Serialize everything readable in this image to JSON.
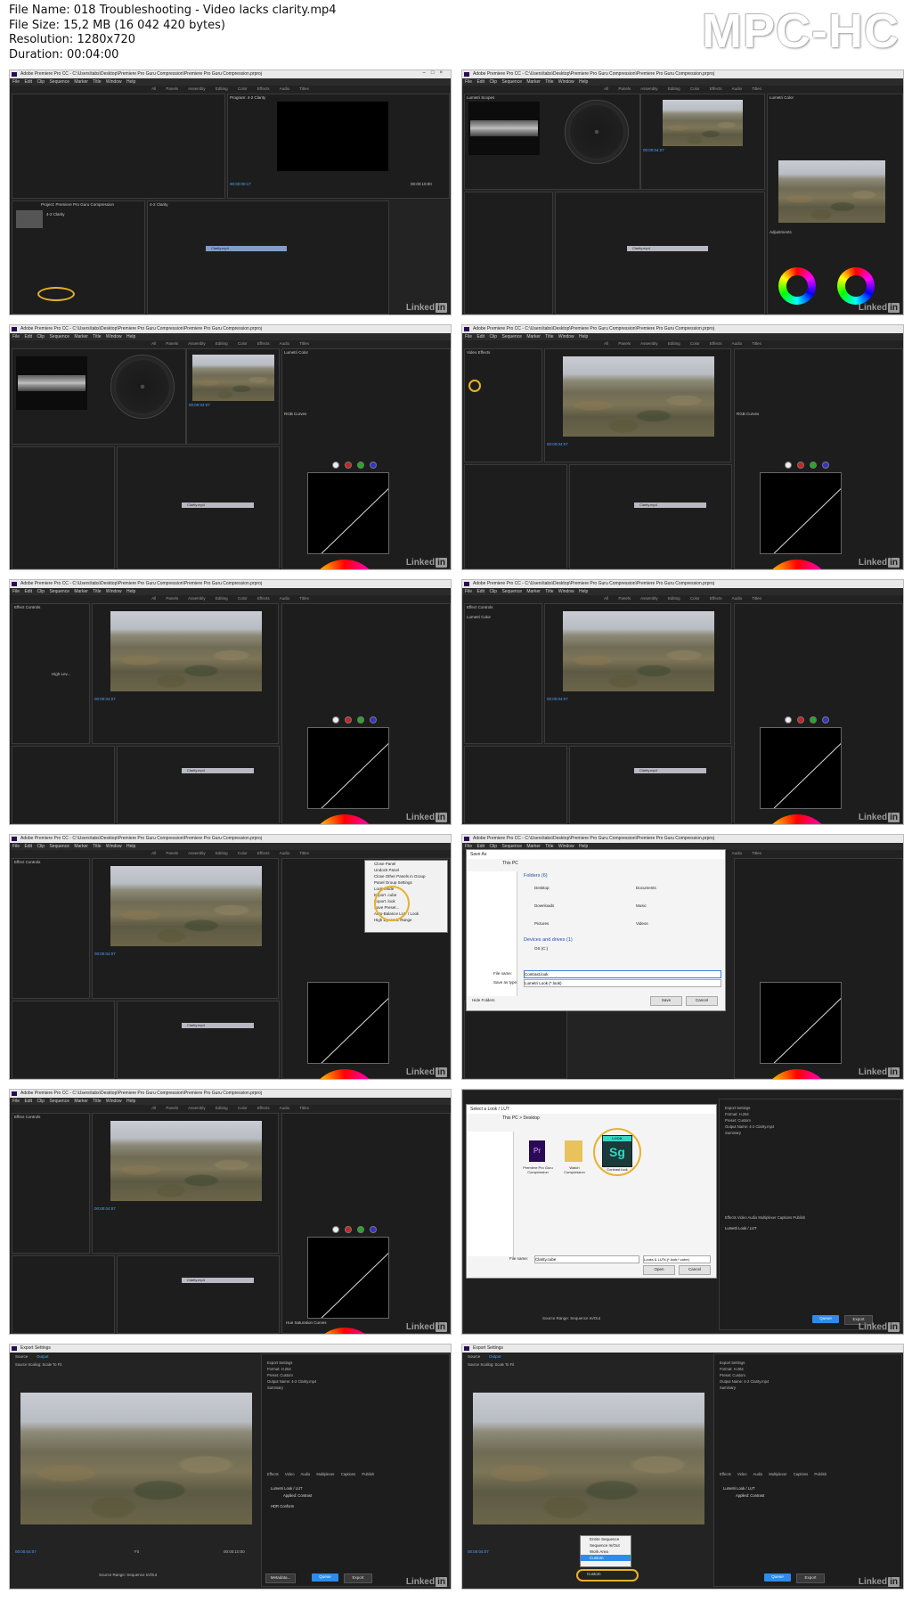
{
  "file_info": {
    "file_name": "File Name: 018 Troubleshooting - Video lacks clarity.mp4",
    "file_size": "File Size: 15,2 MB (16 042 420 bytes)",
    "resolution": "Resolution: 1280x720",
    "duration": "Duration: 00:04:00"
  },
  "logo": "MPC-HC",
  "app": {
    "title": "Adobe Premiere Pro CC - C:\\Users\\tabs\\Desktop\\Premiere Pro Guru Compression\\Premiere Pro Guru Compression.prproj",
    "menu": "File Edit Clip Sequence Marker Title Window Help",
    "workspaces": "All Panels Assembly Editing Color Effects Audio Titles",
    "program_label": "Program: 4-2 Clarity",
    "lumetri_label": "Lumetri Color",
    "timecode_a": "00:00:00:17",
    "timecode_b": "00:00:04:07",
    "timecode_end": "00:00:10:00",
    "clip_name": "Clarity.mp4",
    "watermark": "Linked",
    "watermark_in": "in"
  },
  "frames": [
    {
      "caption": "Project: Premiere Pro Guru Compression",
      "extra": "4-2 Clarity"
    },
    {
      "caption": "Lumetri Scopes",
      "extra": "Adjustments"
    },
    {
      "caption": "Lumetri Scopes",
      "extra": "RGB Curves"
    },
    {
      "caption": "Video Effects",
      "extra": "RGB Curves"
    },
    {
      "caption": "Effect Controls",
      "extra": "High Lev..."
    },
    {
      "caption": "Effect Controls",
      "extra": "Lumetri Color"
    },
    {
      "caption": "Effect Controls",
      "extra": "Export Look"
    },
    {
      "caption": "Save As",
      "extra": "Folders (6)"
    },
    {
      "caption": "Effect Controls",
      "extra": "Hue Saturation Curves"
    },
    {
      "caption": "Select a Look / LUT",
      "extra": "Contrast.look"
    },
    {
      "caption": "Export Settings",
      "extra": "Lumetri Look / LUT"
    },
    {
      "caption": "Export Settings",
      "extra": "Source Range"
    }
  ],
  "context_menu": [
    "Close Panel",
    "Undock Panel",
    "Close Other Panels in Group",
    "Panel Group Settings",
    "Look Mode",
    "Export .cube",
    "Export .look",
    "Save Preset...",
    "Auto-Balance LUT / Look",
    "High Dynamic Range"
  ],
  "save_dialog": {
    "title": "Save As",
    "path": "This PC",
    "folders_title": "Folders (6)",
    "folders": [
      "Desktop",
      "Documents",
      "Downloads",
      "Music",
      "Pictures",
      "Videos"
    ],
    "devices_title": "Devices and drives (1)",
    "drive": "OS (C:)",
    "file_name_label": "File name:",
    "file_name_value": "Contrast.look",
    "save_type_label": "Save as type:",
    "save_type_value": "Lumetri Look (*.look)",
    "save_btn": "Save",
    "cancel_btn": "Cancel",
    "hide_folders": "Hide Folders"
  },
  "open_dialog": {
    "title": "Select a Look / LUT",
    "path": "This PC > Desktop",
    "files": [
      "Premiere Pro Guru Compression",
      "Watch Compression",
      "Contrast.look"
    ],
    "file_name_label": "File name:",
    "file_name_value": "Clarity.cube",
    "filter": "Looks & LUTs (*.look;*.cube)",
    "open_btn": "Open",
    "cancel_btn": "Cancel",
    "sg_label": "Sg",
    "sg_tag": "LOOK"
  },
  "export": {
    "title": "Export Settings",
    "source_tab": "Source",
    "output_tab": "Output",
    "source_scaling": "Source Scaling: Scale To Fit",
    "settings_header": "Export Settings",
    "format": "Format: H.264",
    "preset": "Preset: Custom",
    "output_name": "Output Name: 4-2 Clarity.mp4",
    "summary": "Summary",
    "tabs": "Effects Video Audio Multiplexer Captions Publish",
    "lumetri": "Lumetri Look / LUT",
    "applied": "Applied: Contrast",
    "hdr": "HDR Conform",
    "queue_btn": "Queue",
    "export_btn": "Export",
    "metadata_btn": "Metadata...",
    "cancel_btn": "Cancel",
    "source_range": "Source Range: Sequence In/Out",
    "range_menu": [
      "Entire Sequence",
      "Sequence In/Out",
      "Work Area",
      "Custom"
    ],
    "range_selected": "Custom",
    "timecode": "00:00:04:07",
    "end_timecode": "00:00:10:00",
    "fit": "Fit"
  }
}
